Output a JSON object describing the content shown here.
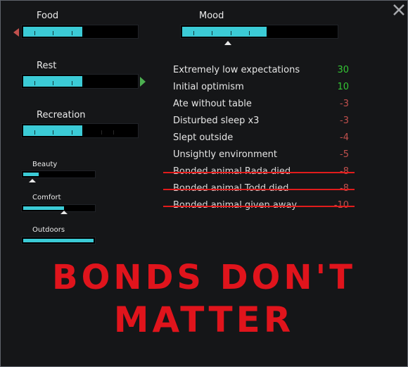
{
  "window": {
    "close_icon": "close-x-icon"
  },
  "needs": {
    "food": {
      "label": "Food",
      "level": 0.52,
      "trend": "down",
      "trend_color": "#c0504d"
    },
    "rest": {
      "label": "Rest",
      "level": 0.52,
      "trend": "up",
      "trend_color": "#4caf50"
    },
    "recreation": {
      "label": "Recreation",
      "level": 0.52
    },
    "beauty": {
      "label": "Beauty",
      "level": 0.22
    },
    "comfort": {
      "label": "Comfort",
      "level": 0.58
    },
    "outdoors": {
      "label": "Outdoors",
      "level": 1.0
    }
  },
  "mood": {
    "label": "Mood",
    "level": 0.55
  },
  "thoughts": [
    {
      "label": "Extremely low expectations",
      "value": "30",
      "color": "#34c634",
      "struck": false
    },
    {
      "label": "Initial optimism",
      "value": "10",
      "color": "#34c634",
      "struck": false
    },
    {
      "label": "Ate without table",
      "value": "-3",
      "color": "#c0504d",
      "struck": false
    },
    {
      "label": "Disturbed sleep x3",
      "value": "-3",
      "color": "#c0504d",
      "struck": false
    },
    {
      "label": "Slept outside",
      "value": "-4",
      "color": "#c0504d",
      "struck": false
    },
    {
      "label": "Unsightly environment",
      "value": "-5",
      "color": "#c0504d",
      "struck": false
    },
    {
      "label": "Bonded animal Rada died",
      "value": "-8",
      "color": "#c0504d",
      "struck": true
    },
    {
      "label": "Bonded animal Todd died",
      "value": "-8",
      "color": "#c0504d",
      "struck": true
    },
    {
      "label": "Bonded animal given away",
      "value": "-10",
      "color": "#c0504d",
      "struck": true
    }
  ],
  "overlay": {
    "line1": "BONDS DON'T",
    "line2": "MATTER",
    "color": "#e0141c"
  },
  "colors": {
    "bar_fill": "#3bcbd6",
    "background": "#151618"
  }
}
